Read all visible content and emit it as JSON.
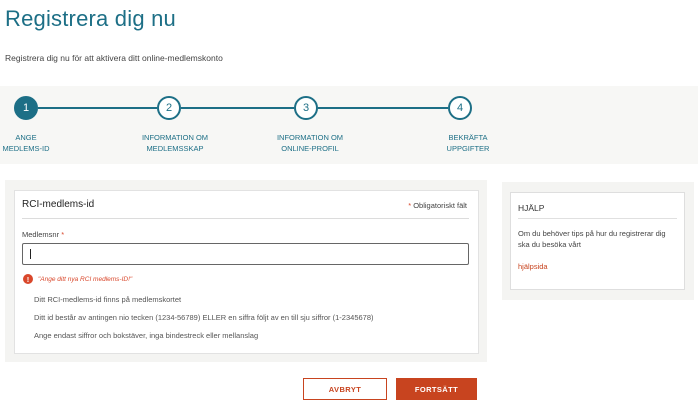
{
  "header": {
    "title": "Registrera dig nu",
    "subtitle": "Registrera dig nu för att aktivera ditt online-medlemskonto"
  },
  "stepper": {
    "active_step": 1,
    "steps": [
      {
        "number": "1",
        "line1": "ANGE",
        "line2": "MEDLEMS-ID"
      },
      {
        "number": "2",
        "line1": "INFORMATION OM",
        "line2": "MEDLEMSSKAP"
      },
      {
        "number": "3",
        "line1": "INFORMATION OM",
        "line2": "ONLINE-PROFIL"
      },
      {
        "number": "4",
        "line1": "BEKRÄFTA",
        "line2": "UPPGIFTER"
      }
    ]
  },
  "form": {
    "title": "RCI-medlems-id",
    "required_star": "*",
    "required_note": "Obligatoriskt fält",
    "field_label": "Medlemsnr",
    "field_value": "",
    "field_placeholder": "",
    "error_icon": "!",
    "error_message": "\"Ange ditt nya RCI medlems-ID!\"",
    "help_lines": [
      "Ditt RCI-medlems-id finns på medlemskortet",
      "Ditt id består av antingen nio tecken (1234-56789) ELLER en siffra följt av en till sju siffror (1-2345678)",
      "Ange endast siffror och bokstäver, inga bindestreck eller mellanslag"
    ]
  },
  "help_panel": {
    "title": "HJÄLP",
    "text": "Om du behöver tips på hur du registrerar dig ska du besöka vårt",
    "link": "hjälpsida"
  },
  "actions": {
    "cancel_label": "AVBRYT",
    "continue_label": "FORTSÄTT"
  },
  "colors": {
    "primary": "#1d6f86",
    "accent": "#c8441f",
    "error": "#d9472b"
  }
}
